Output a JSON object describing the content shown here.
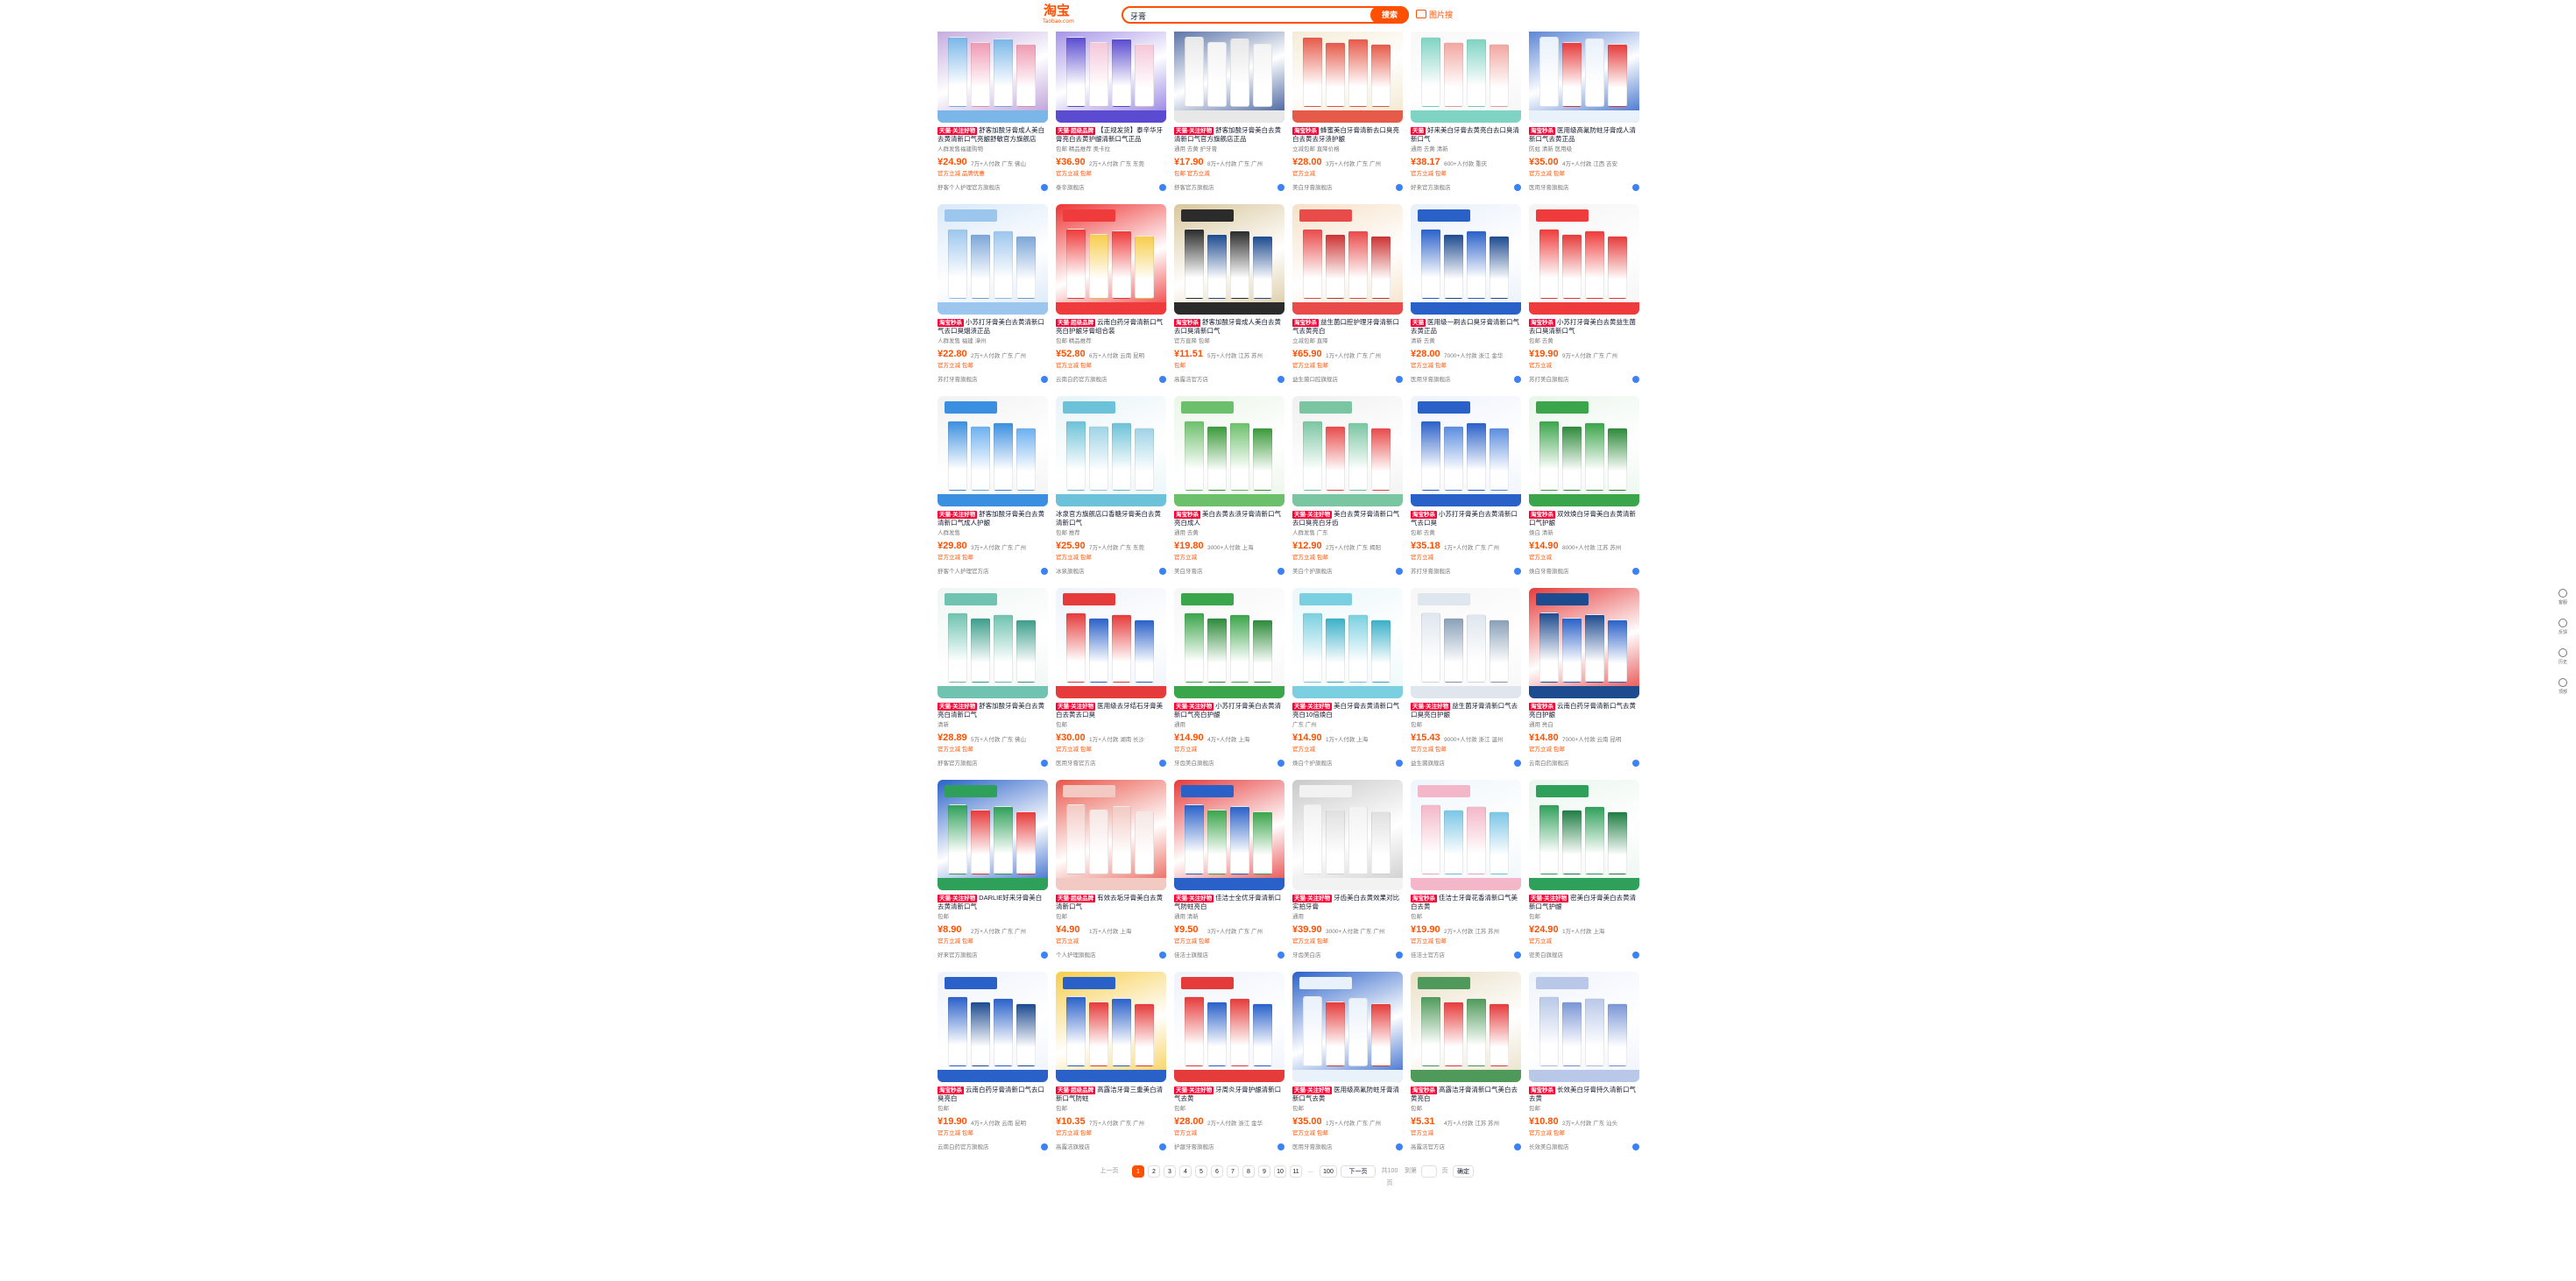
{
  "header": {
    "logo_text": "淘宝",
    "logo_sub": "Taobao.com",
    "search_value": "牙膏",
    "search_button": "搜索",
    "photo_search": "图片搜"
  },
  "products": [
    {
      "tag": "天猫·关注好物",
      "desc": "舒客加酸牙膏成人美白去黄清新口气亮龈舒敏官方旗舰店",
      "meta": "人群发售福建购物",
      "price": "¥24.90",
      "sold": "7万+人付款 广东 佛山",
      "promo": "官方立减 品牌优惠",
      "shop": "舒客个人护理官方旗舰店",
      "c1": "#7ab7e8",
      "c2": "#b493d6",
      "c3": "#ef9ab4"
    },
    {
      "tag": "天猫·超级品牌",
      "desc": "【正规发货】泰辛华牙膏亮白去黄护龈清新口气正品",
      "meta": "包邮 精品推荐 奥卡拉",
      "price": "¥36.90",
      "sold": "2万+人付款 广东 东莞",
      "promo": "官方立减 包邮",
      "shop": "泰辛旗舰店",
      "c1": "#5b4bd0",
      "c2": "#8a74e0",
      "c3": "#f5c7d9"
    },
    {
      "tag": "天猫·关注好物",
      "desc": "舒客加酸牙膏美白去黄清新口气官方旗舰店正品",
      "meta": "通用 去黄 护牙膏",
      "price": "¥17.90",
      "sold": "8万+人付款 广东 广州",
      "promo": "包邮 官方立减",
      "shop": "舒客官方旗舰店",
      "c1": "#e8e8e8",
      "c2": "#2b4c8f",
      "c3": "#f3f3f3"
    },
    {
      "tag": "淘宝秒杀",
      "desc": "蜂蜜美白牙膏清新去口臭亮白去黄去牙渍护龈",
      "meta": "立减包邮 直降价格",
      "price": "¥28.00",
      "sold": "3万+人付款 广东 广州",
      "promo": "官方立减",
      "shop": "美白牙膏旗舰店",
      "c1": "#e65a4a",
      "c2": "#f2e6c9",
      "c3": "#e65a4a"
    },
    {
      "tag": "天猫",
      "desc": "好来美白牙膏去黄亮白去口臭清新口气",
      "meta": "通用 去黄 清新",
      "price": "¥38.17",
      "sold": "600+人付款 重庆",
      "promo": "官方立减 包邮",
      "shop": "好来官方旗舰店",
      "c1": "#7fd3c3",
      "c2": "#f5f5f5",
      "c3": "#f2a7a0"
    },
    {
      "tag": "淘宝秒杀",
      "desc": "医用级高氟防蛀牙膏成人清新口气去黄正品",
      "meta": "防蛀 清新 医用级",
      "price": "¥35.00",
      "sold": "4万+人付款 江西 吉安",
      "promo": "官方立减 包邮",
      "shop": "医用牙膏旗舰店",
      "c1": "#e9f1fb",
      "c2": "#2a61c9",
      "c3": "#e63b3b"
    },
    {
      "tag": "淘宝秒杀",
      "desc": "小苏打牙膏美白去黄清新口气去口臭烟渍正品",
      "meta": "人群发售 福建 漳州",
      "price": "¥22.80",
      "sold": "2万+人付款 广东 广州",
      "promo": "官方立减 包邮",
      "shop": "苏打牙膏旗舰店",
      "c1": "#9cc6ee",
      "c2": "#d8e8f8",
      "c3": "#7ba6d8"
    },
    {
      "tag": "天猫·超级品牌",
      "desc": "云南白药牙膏清新口气亮白护龈牙膏组合装",
      "meta": "包邮 精品推荐",
      "price": "¥52.80",
      "sold": "6万+人付款 云南 昆明",
      "promo": "官方立减 包邮",
      "shop": "云南白药官方旗舰店",
      "c1": "#ef3b3b",
      "c2": "#e33",
      "c3": "#f7cd4b"
    },
    {
      "tag": "淘宝秒杀",
      "desc": "舒客加酸牙膏成人美白去黄去口臭清新口气",
      "meta": "官方直降 包邮",
      "price": "¥11.51",
      "sold": "5万+人付款 江苏 苏州",
      "promo": "包邮",
      "shop": "高露洁官方店",
      "c1": "#2b2b2b",
      "c2": "#d9c79c",
      "c3": "#1d4b8f"
    },
    {
      "tag": "淘宝秒杀",
      "desc": "益生菌口腔护理牙膏清新口气去黄亮白",
      "meta": "立减包邮 直降",
      "price": "¥65.90",
      "sold": "1万+人付款 广东 广州",
      "promo": "官方立减 包邮",
      "shop": "益生菌口腔旗舰店",
      "c1": "#e94a4a",
      "c2": "#f6e1c7",
      "c3": "#c33"
    },
    {
      "tag": "天猫",
      "desc": "医用级一刷去口臭牙膏清新口气去黄正品",
      "meta": "清新 去黄",
      "price": "¥28.00",
      "sold": "7000+人付款 浙江 金华",
      "promo": "官方立减 包邮",
      "shop": "医用牙膏旗舰店",
      "c1": "#2a61c9",
      "c2": "#e8f0fb",
      "c3": "#1d4b8f"
    },
    {
      "tag": "淘宝秒杀",
      "desc": "小苏打牙膏美白去黄益生菌去口臭清新口气",
      "meta": "包邮 去黄",
      "price": "¥19.90",
      "sold": "9万+人付款 广东 广州",
      "promo": "官方立减",
      "shop": "苏打美白旗舰店",
      "c1": "#ef3b3b",
      "c2": "#f4f4f4",
      "c3": "#e63b3b"
    },
    {
      "tag": "天猫·关注好物",
      "desc": "舒客加酸牙膏美白去黄清新口气成人护龈",
      "meta": "人群发售",
      "price": "¥29.80",
      "sold": "3万+人付款 广东 广州",
      "promo": "官方立减 包邮",
      "shop": "舒客个人护理官方店",
      "c1": "#3b8fe0",
      "c2": "#f2f2f2",
      "c3": "#6bb0f0"
    },
    {
      "tag": "",
      "desc": "冰泉官方旗舰店口香糖牙膏美白去黄清新口气",
      "meta": "包邮 推荐",
      "price": "¥25.90",
      "sold": "7万+人付款 广东 东莞",
      "promo": "官方立减 包邮",
      "shop": "冰泉旗舰店",
      "c1": "#6cc2d8",
      "c2": "#e8f4f8",
      "c3": "#9fd3e6"
    },
    {
      "tag": "淘宝秒杀",
      "desc": "美白去黄去渍牙膏清新口气亮白成人",
      "meta": "通用 去黄",
      "price": "¥19.80",
      "sold": "3000+人付款 上海",
      "promo": "官方立减",
      "shop": "美白牙膏店",
      "c1": "#6cc06b",
      "c2": "#eaf6e8",
      "c3": "#3a9a3a"
    },
    {
      "tag": "天猫·关注好物",
      "desc": "美白去黄牙膏清新口气去口臭亮白牙齿",
      "meta": "人群发售 广东",
      "price": "¥12.90",
      "sold": "2万+人付款 广东 揭阳",
      "promo": "官方立减 包邮",
      "shop": "美白个护旗舰店",
      "c1": "#7ac6a2",
      "c2": "#f0f0f0",
      "c3": "#e94a4a"
    },
    {
      "tag": "淘宝秒杀",
      "desc": "小苏打牙膏美白去黄清新口气去口臭",
      "meta": "包邮 去黄",
      "price": "¥35.18",
      "sold": "1万+人付款 广东 广州",
      "promo": "官方立减",
      "shop": "苏打牙膏旗舰店",
      "c1": "#2a61c9",
      "c2": "#eef3fb",
      "c3": "#5a8de0"
    },
    {
      "tag": "淘宝秒杀",
      "desc": "双效焕白牙膏美白去黄清新口气护龈",
      "meta": "焕白 清新",
      "price": "¥14.90",
      "sold": "8000+人付款 江苏 苏州",
      "promo": "官方立减",
      "shop": "焕白牙膏旗舰店",
      "c1": "#3aa54a",
      "c2": "#e9f6ea",
      "c3": "#2c8a3a"
    },
    {
      "tag": "天猫·关注好物",
      "desc": "舒客加酸牙膏美白去黄亮白清新口气",
      "meta": "清新",
      "price": "¥28.89",
      "sold": "5万+人付款 广东 佛山",
      "promo": "官方立减 包邮",
      "shop": "舒客官方旗舰店",
      "c1": "#6fc3b0",
      "c2": "#eef6f4",
      "c3": "#3c9e8c"
    },
    {
      "tag": "天猫·关注好物",
      "desc": "医用级去牙结石牙膏美白去黄去口臭",
      "meta": "包邮",
      "price": "¥30.00",
      "sold": "1万+人付款 湖南 长沙",
      "promo": "官方立减 包邮",
      "shop": "医用牙膏官方店",
      "c1": "#e63b3b",
      "c2": "#eef3fb",
      "c3": "#2a61c9"
    },
    {
      "tag": "天猫·关注好物",
      "desc": "小苏打牙膏美白去黄清新口气亮白护龈",
      "meta": "通用",
      "price": "¥14.90",
      "sold": "4万+人付款 上海",
      "promo": "官方立减",
      "shop": "牙齿美白旗舰店",
      "c1": "#3aa54a",
      "c2": "#f6f6f6",
      "c3": "#2c8a3a"
    },
    {
      "tag": "天猫·关注好物",
      "desc": "美白牙膏去黄清新口气亮白10倍焕白",
      "meta": "广东 广州",
      "price": "¥14.90",
      "sold": "1万+人付款 上海",
      "promo": "官方立减",
      "shop": "焕白个护旗舰店",
      "c1": "#7ad0e0",
      "c2": "#eaf7fa",
      "c3": "#3ab0c8"
    },
    {
      "tag": "天猫·关注好物",
      "desc": "益生菌牙膏清新口气去口臭亮白护龈",
      "meta": "包邮",
      "price": "¥15.43",
      "sold": "9000+人付款 浙江 温州",
      "promo": "官方立减 包邮",
      "shop": "益生菌旗舰店",
      "c1": "#dfe6ee",
      "c2": "#f6f6f6",
      "c3": "#8aa0b8"
    },
    {
      "tag": "淘宝秒杀",
      "desc": "云南白药牙膏清新口气去黄亮白护龈",
      "meta": "通用 亮白",
      "price": "¥14.80",
      "sold": "7000+人付款 云南 昆明",
      "promo": "官方立减 包邮",
      "shop": "云南白药旗舰店",
      "c1": "#1d4b8f",
      "c2": "#e63b3b",
      "c3": "#2a61c9"
    },
    {
      "tag": "天猫·关注好物",
      "desc": "DARLIE好来牙膏美白去黄清新口气",
      "meta": "包邮",
      "price": "¥8.90",
      "sold": "2万+人付款 广东 广州",
      "promo": "官方立减 包邮",
      "shop": "好来官方旗舰店",
      "c1": "#2fa05a",
      "c2": "#2a61c9",
      "c3": "#e63b3b"
    },
    {
      "tag": "天猫·超级品牌",
      "desc": "有效去垢牙膏美白去黄清新口气",
      "meta": "包邮",
      "price": "¥4.90",
      "sold": "1万+人付款 上海",
      "promo": "官方立减",
      "shop": "个人护理旗舰店",
      "c1": "#f3c9c3",
      "c2": "#e9564a",
      "c3": "#f6e6e3"
    },
    {
      "tag": "天猫·关注好物",
      "desc": "佳洁士全优牙膏清新口气防蛀亮白",
      "meta": "通用 清新",
      "price": "¥9.50",
      "sold": "3万+人付款 广东 广州",
      "promo": "官方立减 包邮",
      "shop": "佳洁士旗舰店",
      "c1": "#2a61c9",
      "c2": "#e63b3b",
      "c3": "#3aa54a"
    },
    {
      "tag": "天猫·关注好物",
      "desc": "牙齿美白去黄效果对比实拍牙膏",
      "meta": "通用",
      "price": "¥39.90",
      "sold": "3000+人付款 广东 广州",
      "promo": "官方立减 包邮",
      "shop": "牙齿美白店",
      "c1": "#f2f2f2",
      "c2": "#c9c9c9",
      "c3": "#e0e0e0"
    },
    {
      "tag": "淘宝秒杀",
      "desc": "佳洁士牙膏花香清新口气美白去黄",
      "meta": "包邮",
      "price": "¥19.90",
      "sold": "2万+人付款 江苏 苏州",
      "promo": "官方立减 包邮",
      "shop": "佳洁士官方店",
      "c1": "#f4b7c9",
      "c2": "#eef6fb",
      "c3": "#7bc6e6"
    },
    {
      "tag": "天猫·关注好物",
      "desc": "密美白牙膏美白去黄清新口气护龈",
      "meta": "包邮",
      "price": "¥24.90",
      "sold": "1万+人付款 上海",
      "promo": "官方立减",
      "shop": "密美白旗舰店",
      "c1": "#2fa05a",
      "c2": "#eaf6ee",
      "c3": "#1f7e44"
    },
    {
      "tag": "淘宝秒杀",
      "desc": "云南白药牙膏清新口气去口臭亮白",
      "meta": "包邮",
      "price": "¥19.90",
      "sold": "4万+人付款 云南 昆明",
      "promo": "官方立减 包邮",
      "shop": "云南白药官方旗舰店",
      "c1": "#2a61c9",
      "c2": "#eef3fb",
      "c3": "#1d4b8f"
    },
    {
      "tag": "天猫·超级品牌",
      "desc": "高露洁牙膏三重美白清新口气防蛀",
      "meta": "包邮",
      "price": "¥10.35",
      "sold": "7万+人付款 广东 广州",
      "promo": "官方立减 包邮",
      "shop": "高露洁旗舰店",
      "c1": "#2a61c9",
      "c2": "#f7cd4b",
      "c3": "#e63b3b"
    },
    {
      "tag": "天猫·关注好物",
      "desc": "牙周炎牙膏护龈清新口气去黄",
      "meta": "包邮",
      "price": "¥28.00",
      "sold": "2万+人付款 浙江 金华",
      "promo": "官方立减",
      "shop": "护龈牙膏旗舰店",
      "c1": "#e63b3b",
      "c2": "#eef3fb",
      "c3": "#2a61c9"
    },
    {
      "tag": "天猫·关注好物",
      "desc": "医用级高氟防蛀牙膏清新口气去黄",
      "meta": "包邮",
      "price": "¥35.00",
      "sold": "1万+人付款 广东 广州",
      "promo": "官方立减 包邮",
      "shop": "医用牙膏旗舰店",
      "c1": "#e9f1fb",
      "c2": "#2a61c9",
      "c3": "#e63b3b"
    },
    {
      "tag": "淘宝秒杀",
      "desc": "高露洁牙膏清新口气美白去黄亮白",
      "meta": "包邮",
      "price": "¥5.31",
      "sold": "4万+人付款 江苏 苏州",
      "promo": "官方立减",
      "shop": "高露洁官方店",
      "c1": "#4f9a5a",
      "c2": "#e9dfc6",
      "c3": "#e63b3b"
    },
    {
      "tag": "淘宝秒杀",
      "desc": "长效美白牙膏持久清新口气去黄",
      "meta": "包邮",
      "price": "¥10.80",
      "sold": "2万+人付款 广东 汕头",
      "promo": "官方立减 包邮",
      "shop": "长效美白旗舰店",
      "c1": "#b9c8e8",
      "c2": "#eef3fb",
      "c3": "#7b96d6"
    }
  ],
  "pagination": {
    "prev": "上一页",
    "pages": [
      "1",
      "2",
      "3",
      "4",
      "5",
      "6",
      "7",
      "8",
      "9",
      "10",
      "11"
    ],
    "ellipsis": "...",
    "last": "100",
    "next": "下一页",
    "total": "共100页",
    "goto": "到第",
    "page_suffix": "页",
    "confirm": "确定"
  },
  "floating_sidebar": [
    "客服",
    "反馈",
    "历史",
    "顶部"
  ]
}
